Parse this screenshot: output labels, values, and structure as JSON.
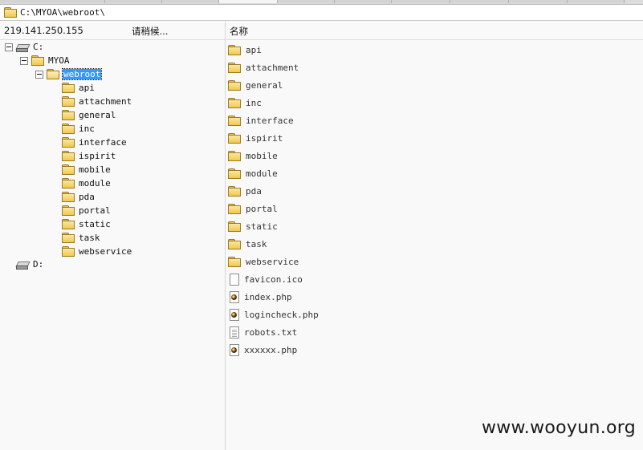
{
  "address": {
    "path": "C:\\MYOA\\webroot\\"
  },
  "status": {
    "ip": "219.141.250.155",
    "waiting": "请稍候..."
  },
  "filelist": {
    "column_header": "名称",
    "items": [
      {
        "name": "api",
        "type": "folder"
      },
      {
        "name": "attachment",
        "type": "folder"
      },
      {
        "name": "general",
        "type": "folder"
      },
      {
        "name": "inc",
        "type": "folder"
      },
      {
        "name": "interface",
        "type": "folder"
      },
      {
        "name": "ispirit",
        "type": "folder"
      },
      {
        "name": "mobile",
        "type": "folder"
      },
      {
        "name": "module",
        "type": "folder"
      },
      {
        "name": "pda",
        "type": "folder"
      },
      {
        "name": "portal",
        "type": "folder"
      },
      {
        "name": "static",
        "type": "folder"
      },
      {
        "name": "task",
        "type": "folder"
      },
      {
        "name": "webservice",
        "type": "folder"
      },
      {
        "name": "favicon.ico",
        "type": "file"
      },
      {
        "name": "index.php",
        "type": "php"
      },
      {
        "name": "logincheck.php",
        "type": "php"
      },
      {
        "name": "robots.txt",
        "type": "txt"
      },
      {
        "name": "xxxxxx.php",
        "type": "php"
      }
    ]
  },
  "tree": {
    "drive_c": "C:",
    "myoa": "MYOA",
    "webroot": "webroot",
    "children": [
      "api",
      "attachment",
      "general",
      "inc",
      "interface",
      "ispirit",
      "mobile",
      "module",
      "pda",
      "portal",
      "static",
      "task",
      "webservice"
    ],
    "drive_d": "D:"
  },
  "watermark": "www.wooyun.org",
  "colors": {
    "selection": "#3399ff",
    "folder": "#f0c850"
  }
}
